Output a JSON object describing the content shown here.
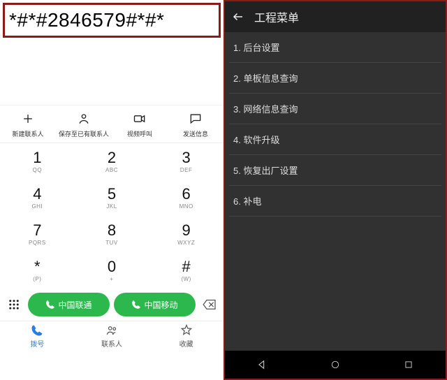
{
  "dialer": {
    "display": "*#*#2846579#*#*",
    "actions": [
      {
        "label": "新建联系人"
      },
      {
        "label": "保存至已有联系人"
      },
      {
        "label": "视频呼叫"
      },
      {
        "label": "发送信息"
      }
    ],
    "keys": [
      {
        "digit": "1",
        "sub": "QQ"
      },
      {
        "digit": "2",
        "sub": "ABC"
      },
      {
        "digit": "3",
        "sub": "DEF"
      },
      {
        "digit": "4",
        "sub": "GHI"
      },
      {
        "digit": "5",
        "sub": "JKL"
      },
      {
        "digit": "6",
        "sub": "MNO"
      },
      {
        "digit": "7",
        "sub": "PQRS"
      },
      {
        "digit": "8",
        "sub": "TUV"
      },
      {
        "digit": "9",
        "sub": "WXYZ"
      },
      {
        "digit": "*",
        "sub": "(P)"
      },
      {
        "digit": "0",
        "sub": "+"
      },
      {
        "digit": "#",
        "sub": "(W)"
      }
    ],
    "call_buttons": [
      {
        "label": "中国联通"
      },
      {
        "label": "中国移动"
      }
    ],
    "bottom_nav": [
      {
        "label": "拨号"
      },
      {
        "label": "联系人"
      },
      {
        "label": "收藏"
      }
    ]
  },
  "eng_menu": {
    "title": "工程菜单",
    "items": [
      "1. 后台设置",
      "2. 单板信息查询",
      "3. 网络信息查询",
      "4. 软件升级",
      "5. 恢复出厂设置",
      "6. 补电"
    ]
  }
}
